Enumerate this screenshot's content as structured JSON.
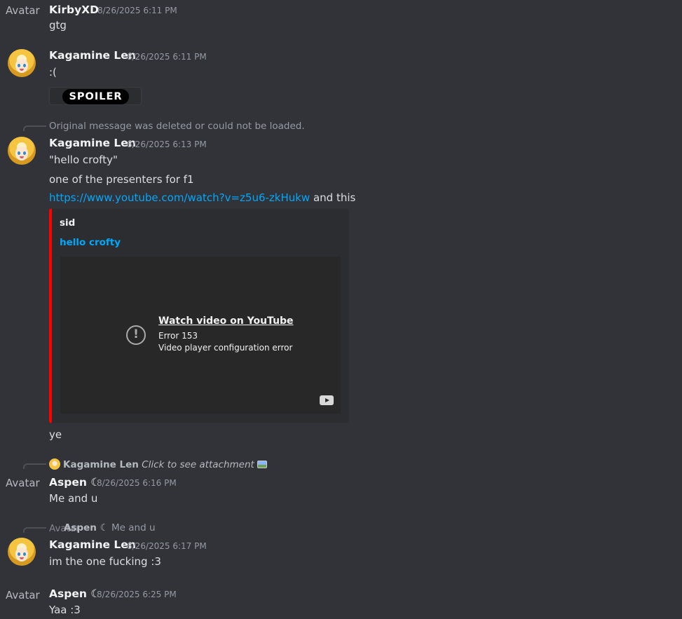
{
  "messages": [
    {
      "avatar_alt": "Avatar",
      "author": "KirbyXD",
      "timestamp": "8/26/2025 6:11 PM",
      "lines": [
        "gtg"
      ]
    },
    {
      "author": "Kagamine Len",
      "timestamp": "8/26/2025 6:11 PM",
      "lines": [
        ":("
      ],
      "spoiler_label": "SPOILER"
    },
    {
      "reply_text": "Original message was deleted or could not be loaded.",
      "author": "Kagamine Len",
      "timestamp": "8/26/2025 6:13 PM",
      "lines": [
        "\"hello crofty\"",
        "one of the presenters for f1",
        "and this",
        "ye"
      ],
      "link": "https://www.youtube.com/watch?v=z5u6-zkHukw",
      "embed": {
        "provider": "sid",
        "title": "hello crofty",
        "video_error_title": "Watch video on YouTube",
        "video_error_code": "Error 153",
        "video_error_detail": "Video player configuration error",
        "accent_color": "#ff0000"
      }
    },
    {
      "reply": {
        "author": "Kagamine Len",
        "text": "Click to see attachment"
      },
      "avatar_alt": "Avatar",
      "author": "Aspen ☾",
      "timestamp": "8/26/2025 6:16 PM",
      "lines": [
        "Me and u"
      ]
    },
    {
      "reply": {
        "avatar_alt": "Avatar",
        "author": "Aspen ☾",
        "text": "Me and u"
      },
      "author": "Kagamine Len",
      "timestamp": "8/26/2025 6:17 PM",
      "lines": [
        "im the one fucking :3"
      ]
    },
    {
      "avatar_alt": "Avatar",
      "author": "Aspen ☾",
      "timestamp": "8/26/2025 6:25 PM",
      "lines": [
        "Yaa :3"
      ]
    }
  ],
  "icons": {
    "error": "alert-circle-icon",
    "youtube": "youtube-icon",
    "image": "image-icon"
  },
  "colors": {
    "background": "#323339",
    "link": "#00a8fc",
    "embed_background": "#2b2d31"
  }
}
